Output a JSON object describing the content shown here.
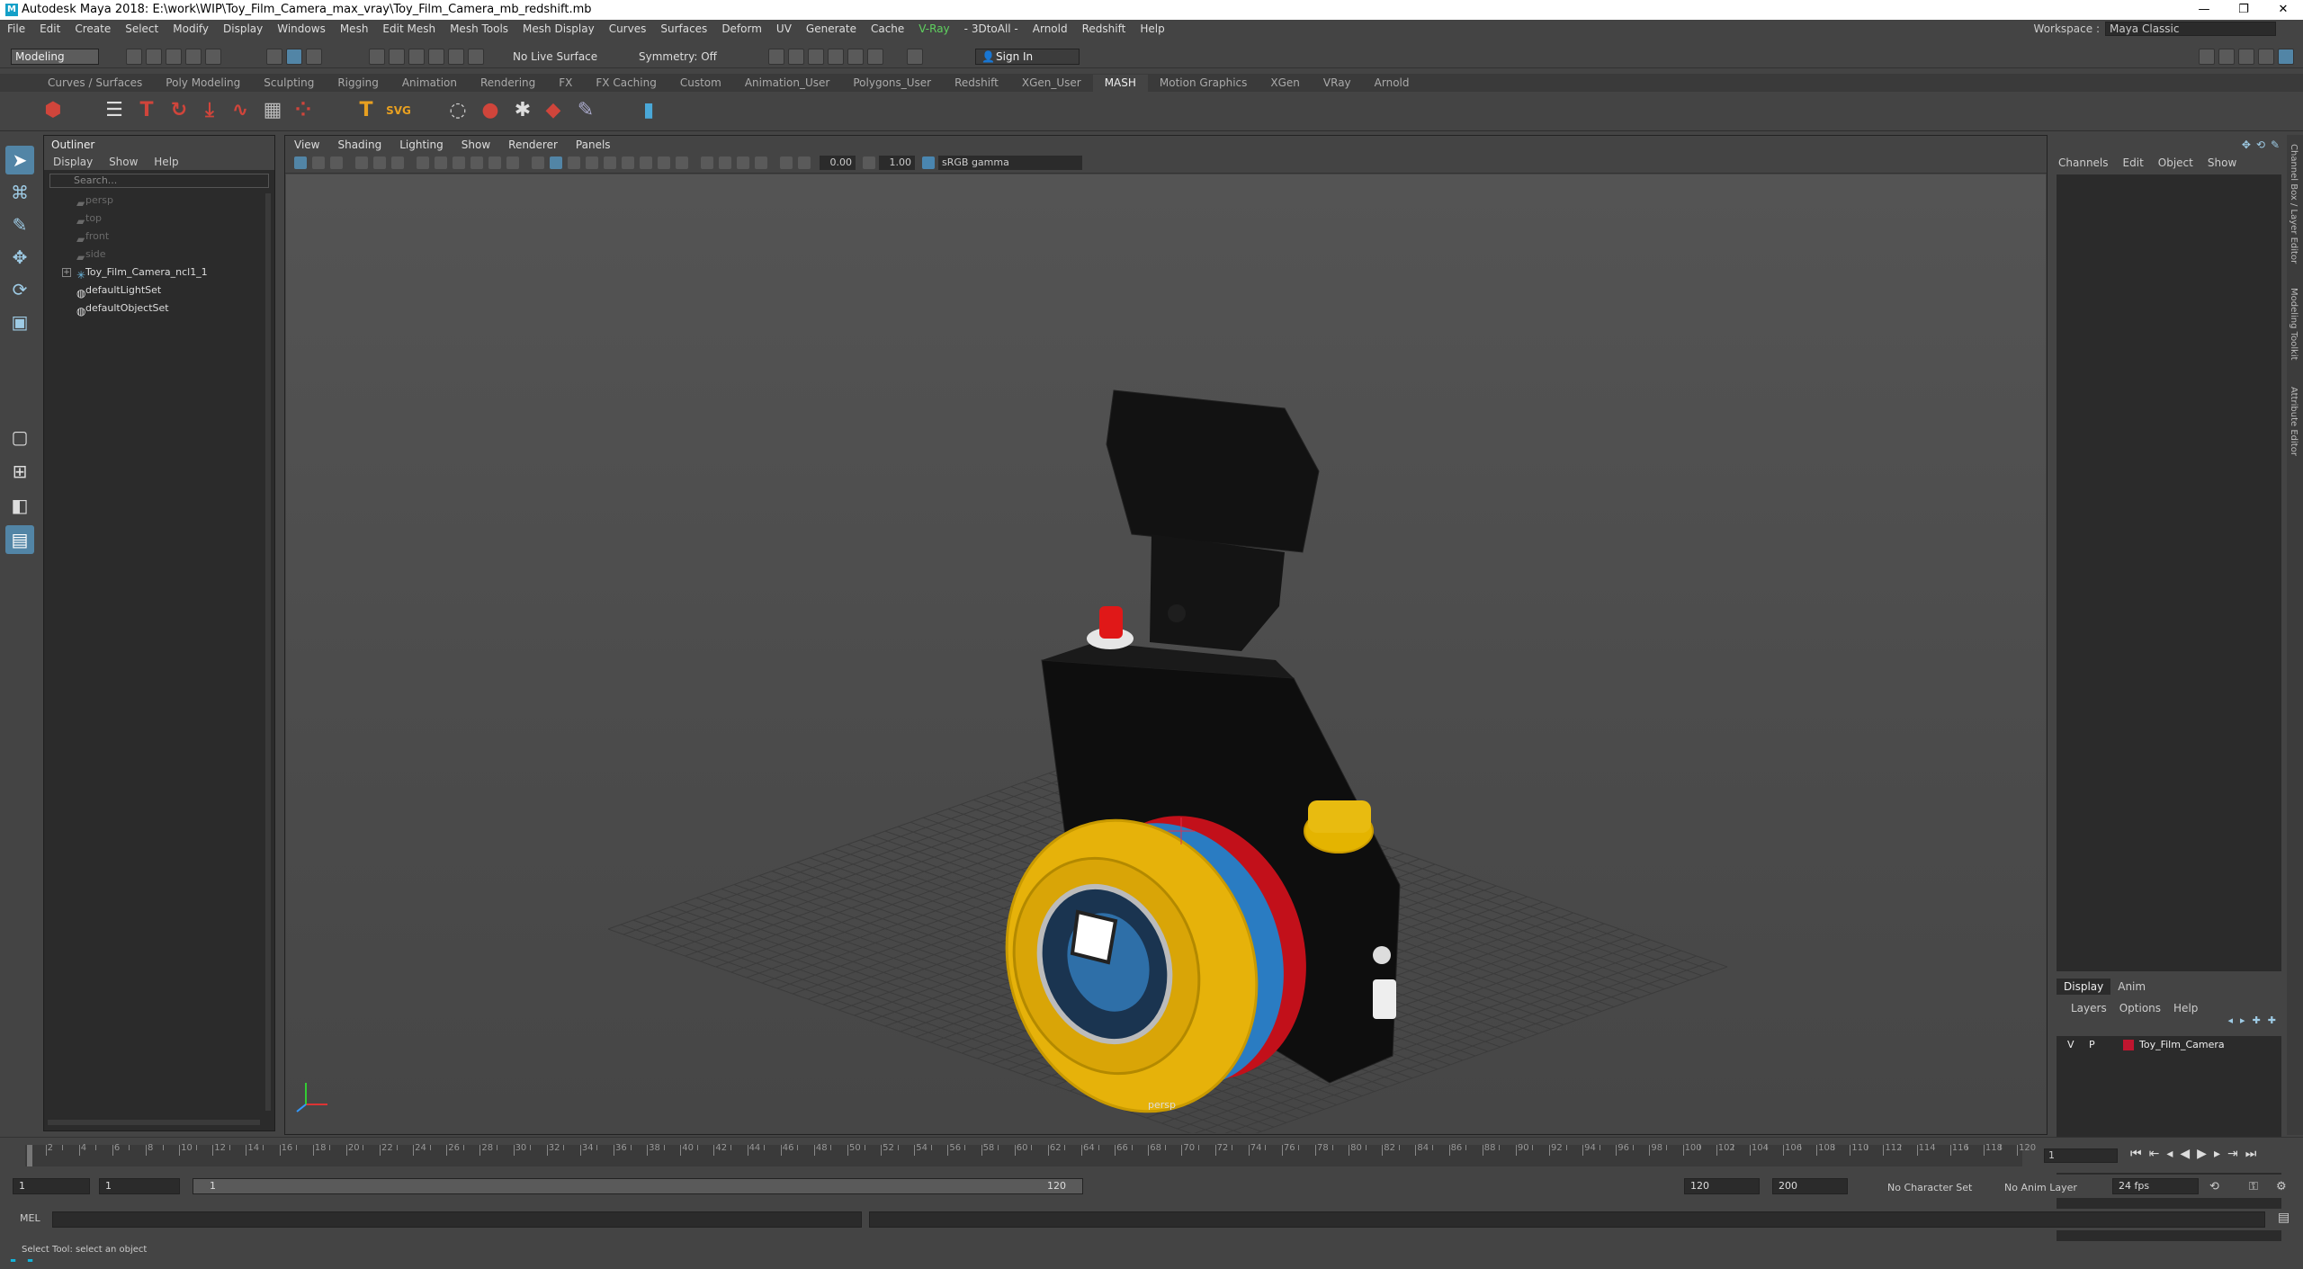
{
  "titlebar": {
    "title": "Autodesk Maya 2018: E:\\work\\WIP\\Toy_Film_Camera_max_vray\\Toy_Film_Camera_mb_redshift.mb",
    "minimize": "—",
    "restore": "❐",
    "close": "✕"
  },
  "menubar": {
    "items": [
      "File",
      "Edit",
      "Create",
      "Select",
      "Modify",
      "Display",
      "Windows",
      "Mesh",
      "Edit Mesh",
      "Mesh Tools",
      "Mesh Display",
      "Curves",
      "Surfaces",
      "Deform",
      "UV",
      "Generate",
      "Cache",
      "V-Ray",
      "- 3DtoAll -",
      "Arnold",
      "Redshift",
      "Help"
    ]
  },
  "workspace": {
    "label": "Workspace :",
    "value": "Maya Classic"
  },
  "statusline": {
    "mode": "Modeling",
    "live_surface": "No Live Surface",
    "symmetry": "Symmetry: Off",
    "sign_in": "Sign In"
  },
  "shelf": {
    "tabs": [
      "Curves / Surfaces",
      "Poly Modeling",
      "Sculpting",
      "Rigging",
      "Animation",
      "Rendering",
      "FX",
      "FX Caching",
      "Custom",
      "Animation_User",
      "Polygons_User",
      "Redshift",
      "XGen_User",
      "MASH",
      "Motion Graphics",
      "XGen",
      "VRay",
      "Arnold"
    ],
    "active_tab": "MASH"
  },
  "outliner": {
    "title": "Outliner",
    "menu": [
      "Display",
      "Show",
      "Help"
    ],
    "search_placeholder": "Search...",
    "items": [
      {
        "label": "persp",
        "dim": true
      },
      {
        "label": "top",
        "dim": true
      },
      {
        "label": "front",
        "dim": true
      },
      {
        "label": "side",
        "dim": true
      },
      {
        "label": "Toy_Film_Camera_ncl1_1",
        "dim": false,
        "expandable": true
      },
      {
        "label": "defaultLightSet",
        "dim": false
      },
      {
        "label": "defaultObjectSet",
        "dim": false
      }
    ]
  },
  "viewport": {
    "menu": [
      "View",
      "Shading",
      "Lighting",
      "Show",
      "Renderer",
      "Panels"
    ],
    "exposure": "0.00",
    "gamma": "1.00",
    "color_space": "sRGB gamma",
    "camera_label": "persp"
  },
  "channelbox": {
    "menu": [
      "Channels",
      "Edit",
      "Object",
      "Show"
    ]
  },
  "layereditor": {
    "tabs": [
      "Display",
      "Anim"
    ],
    "menu": [
      "Layers",
      "Options",
      "Help"
    ],
    "layers": [
      {
        "v": "V",
        "p": "P",
        "name": "Toy_Film_Camera",
        "color": "#c0152f"
      }
    ]
  },
  "sidetabs": [
    "Channel Box / Layer Editor",
    "Modeling Toolkit",
    "Attribute Editor"
  ],
  "timeslider": {
    "current_frame": "1",
    "labels": [
      "2",
      "4",
      "6",
      "8",
      "10",
      "12",
      "14",
      "16",
      "18",
      "20",
      "22",
      "24",
      "26",
      "28",
      "30",
      "32",
      "34",
      "36",
      "38",
      "40",
      "42",
      "44",
      "46",
      "48",
      "50",
      "52",
      "54",
      "56",
      "58",
      "60",
      "62",
      "64",
      "66",
      "68",
      "70",
      "72",
      "74",
      "76",
      "78",
      "80",
      "82",
      "84",
      "86",
      "88",
      "90",
      "92",
      "94",
      "96",
      "98",
      "100",
      "102",
      "104",
      "106",
      "108",
      "110",
      "112",
      "114",
      "116",
      "118",
      "120"
    ]
  },
  "range": {
    "start": "1",
    "playback_start": "1",
    "slider_start": "1",
    "slider_end": "120",
    "playback_end": "120",
    "end": "200",
    "character_set": "No Character Set",
    "anim_layer": "No Anim Layer",
    "fps": "24 fps"
  },
  "cmdline": {
    "label": "MEL"
  },
  "statusbar": {
    "text": "Select Tool: select an object"
  }
}
